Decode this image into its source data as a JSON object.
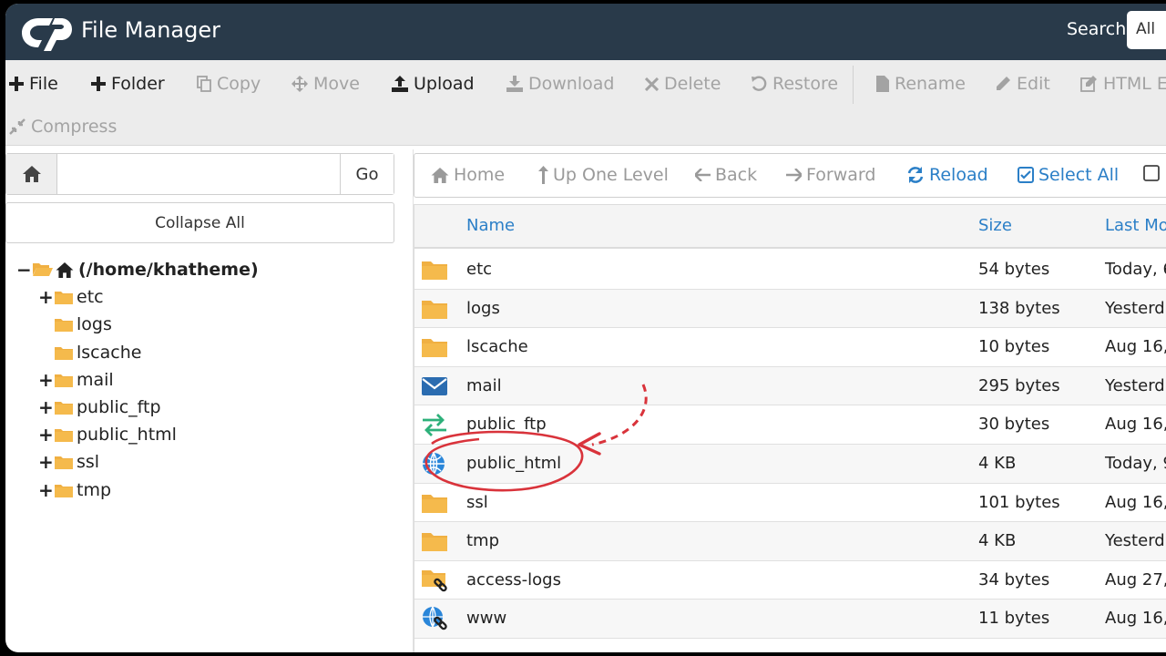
{
  "header": {
    "app_title": "File Manager",
    "search_label": "Search",
    "search_scope": "All"
  },
  "toolbar": {
    "file": "File",
    "folder": "Folder",
    "copy": "Copy",
    "move": "Move",
    "upload": "Upload",
    "download": "Download",
    "delete": "Delete",
    "restore": "Restore",
    "rename": "Rename",
    "edit": "Edit",
    "html_editor": "HTML E",
    "compress": "Compress"
  },
  "path_bar": {
    "value": "",
    "go_label": "Go"
  },
  "collapse_label": "Collapse All",
  "tree": {
    "root": "(/home/khatheme)",
    "items": [
      {
        "label": "etc",
        "expandable": true
      },
      {
        "label": "logs",
        "expandable": false
      },
      {
        "label": "lscache",
        "expandable": false
      },
      {
        "label": "mail",
        "expandable": true
      },
      {
        "label": "public_ftp",
        "expandable": true
      },
      {
        "label": "public_html",
        "expandable": true
      },
      {
        "label": "ssl",
        "expandable": true
      },
      {
        "label": "tmp",
        "expandable": true
      }
    ]
  },
  "nav": {
    "home": "Home",
    "up": "Up One Level",
    "back": "Back",
    "forward": "Forward",
    "reload": "Reload",
    "select_all": "Select All"
  },
  "table": {
    "columns": {
      "name": "Name",
      "size": "Size",
      "modified": "Last Mo"
    },
    "rows": [
      {
        "icon": "folder-icon",
        "name": "etc",
        "size": "54 bytes",
        "modified": "Today, 6"
      },
      {
        "icon": "folder-icon",
        "name": "logs",
        "size": "138 bytes",
        "modified": "Yesterd"
      },
      {
        "icon": "folder-icon",
        "name": "lscache",
        "size": "10 bytes",
        "modified": "Aug 16,"
      },
      {
        "icon": "mail-icon",
        "name": "mail",
        "size": "295 bytes",
        "modified": "Yesterd"
      },
      {
        "icon": "transfer-icon",
        "name": "public_ftp",
        "size": "30 bytes",
        "modified": "Aug 16,"
      },
      {
        "icon": "globe-icon",
        "name": "public_html",
        "size": "4 KB",
        "modified": "Today, 9"
      },
      {
        "icon": "folder-icon",
        "name": "ssl",
        "size": "101 bytes",
        "modified": "Aug 16,"
      },
      {
        "icon": "folder-icon",
        "name": "tmp",
        "size": "4 KB",
        "modified": "Yesterd"
      },
      {
        "icon": "folder-link-icon",
        "name": "access-logs",
        "size": "34 bytes",
        "modified": "Aug 27,"
      },
      {
        "icon": "globe-link-icon",
        "name": "www",
        "size": "11 bytes",
        "modified": "Aug 16,"
      }
    ]
  },
  "colors": {
    "header_bg": "#293a4a",
    "link_blue": "#2b7fc7",
    "folder": "#f0b042",
    "annotation_red": "#d9333b"
  }
}
